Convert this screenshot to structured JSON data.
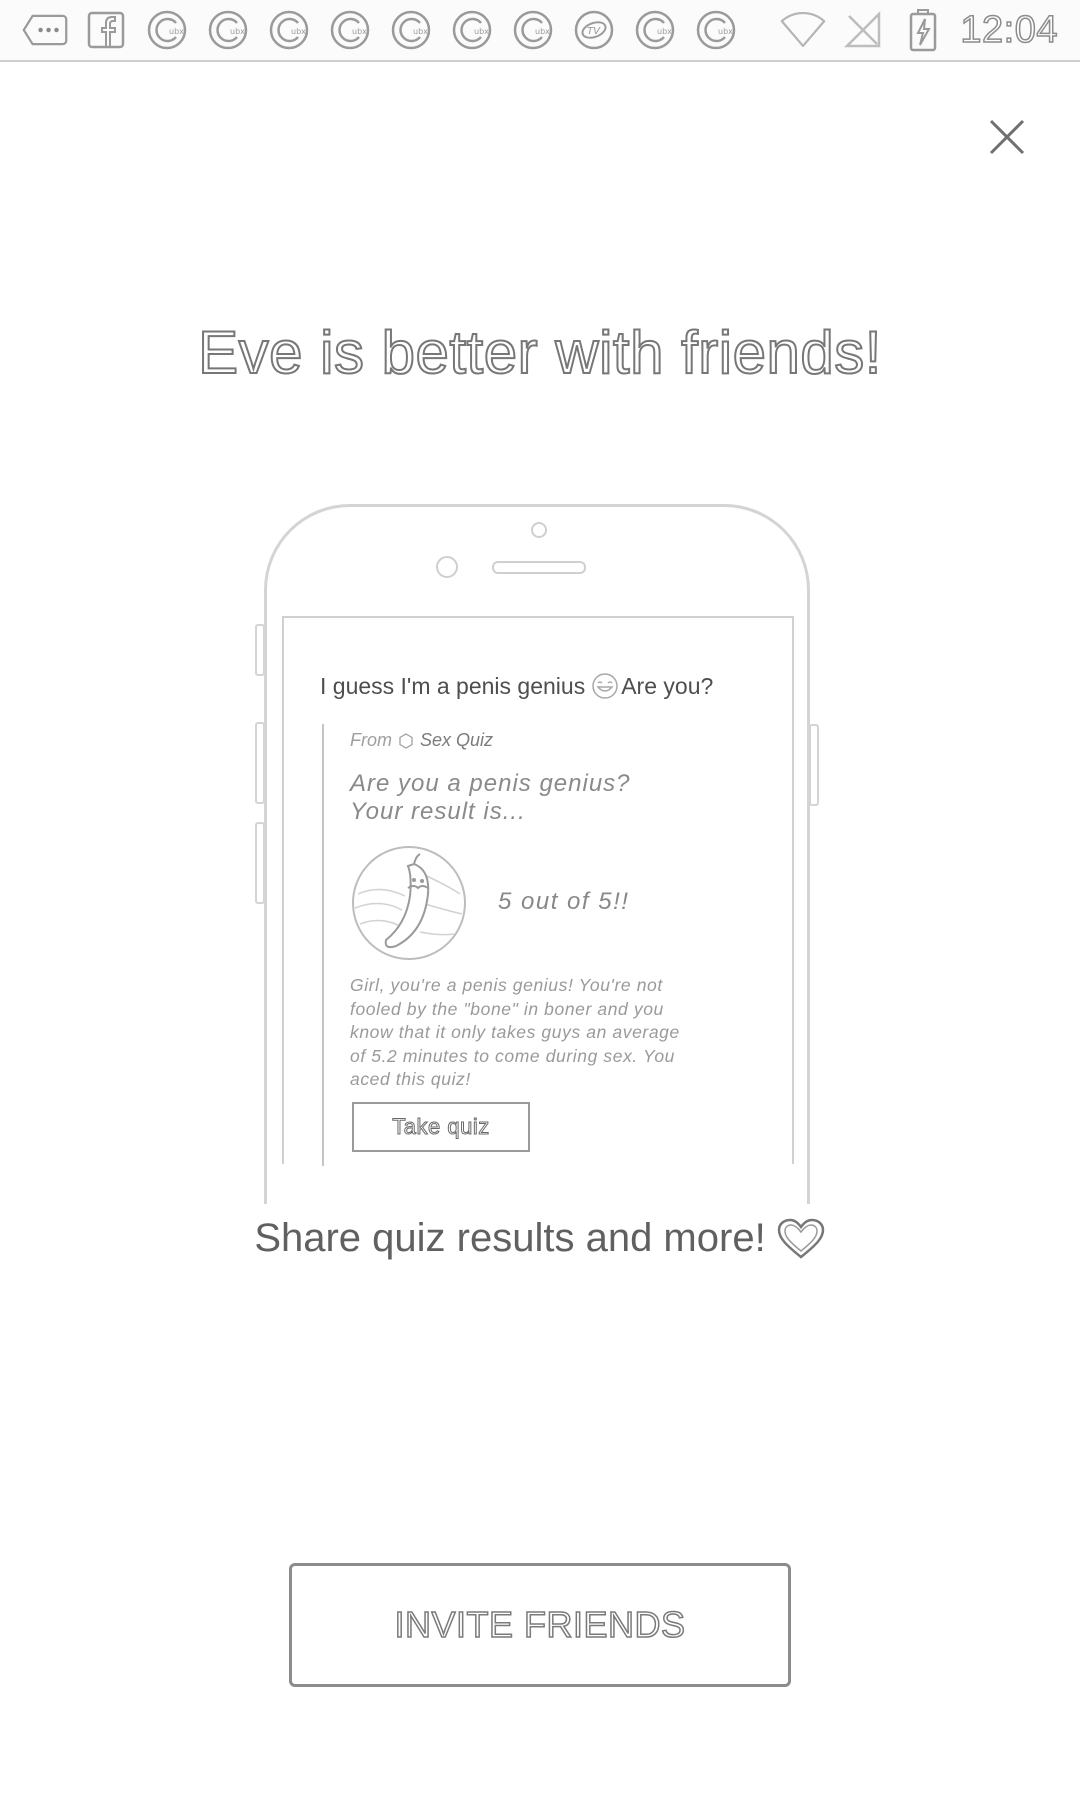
{
  "status_bar": {
    "time": "12:04",
    "notification_icons": [
      "more-icon",
      "facebook-icon",
      "clubs-icon",
      "clubs-icon",
      "clubs-icon",
      "clubs-icon",
      "clubs-icon",
      "clubs-icon",
      "clubs-icon",
      "tv-icon",
      "clubs-icon",
      "clubs-icon"
    ],
    "system_icons": [
      "wifi-icon",
      "no-sim-icon",
      "battery-charging-icon"
    ]
  },
  "close_icon": "close-icon",
  "title": "Eve is better with friends!",
  "preview": {
    "message_before": "I guess I'm a penis genius",
    "message_emoji": "grinning-face-icon",
    "message_after": "Are you?",
    "from_label": "From",
    "from_icon": "hexagon-icon",
    "from_name": "Sex Quiz",
    "question_line1": "Are you a penis genius?",
    "question_line2": "Your result is...",
    "result_image": "cucumber-icon",
    "score": "5 out of 5!!",
    "description_lines": [
      "Girl, you're a penis genius! You're not",
      "fooled by the \"bone\" in boner and you",
      "know that it only takes guys an average",
      "of 5.2 minutes to come during sex. You",
      "aced this quiz!"
    ],
    "take_quiz_label": "Take quiz"
  },
  "share_text": "Share quiz results and more!",
  "share_icon": "heart-icon",
  "invite_label": "INVITE FRIENDS"
}
